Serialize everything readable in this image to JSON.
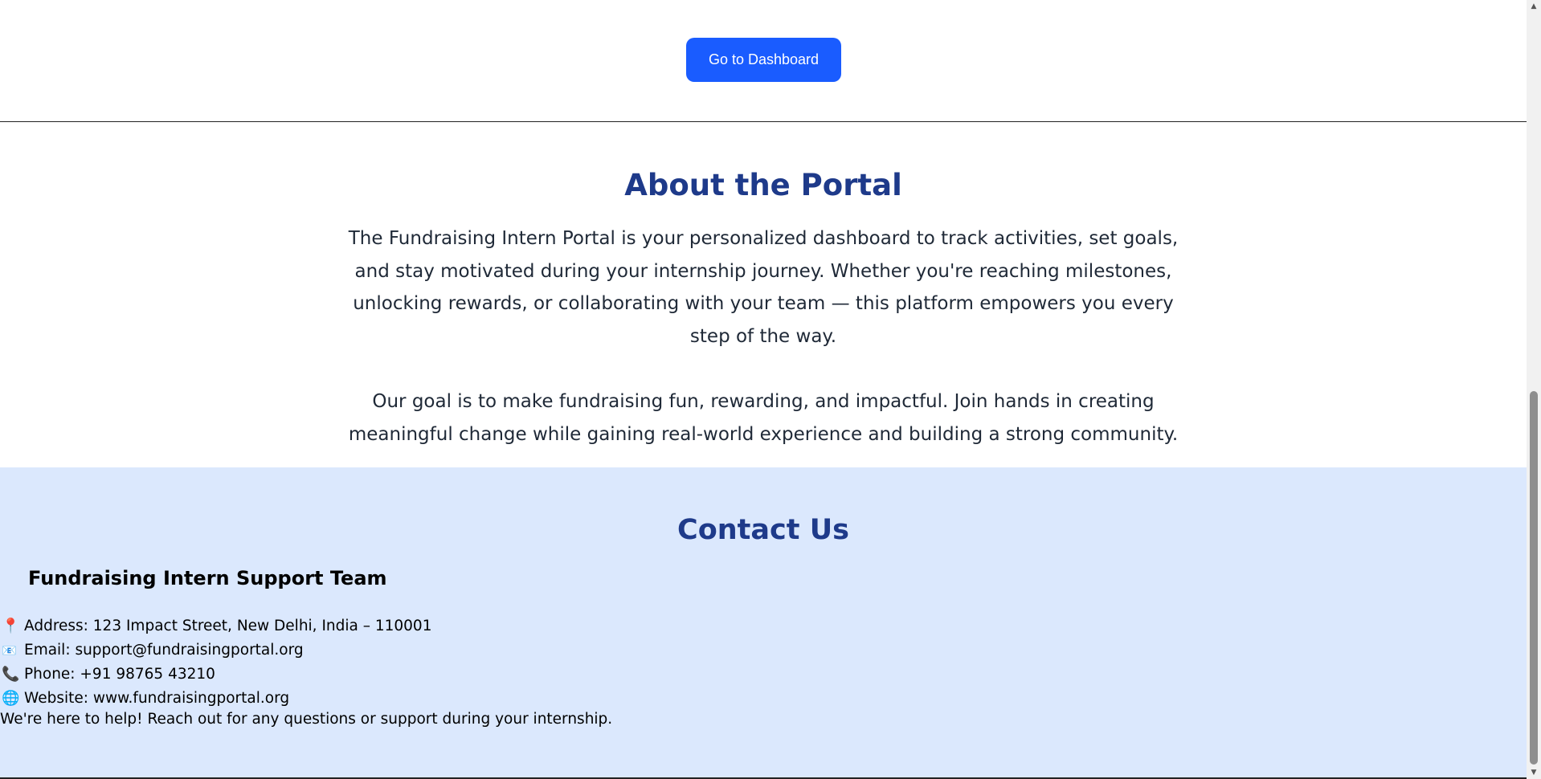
{
  "top": {
    "dashboard_button": "Go to Dashboard"
  },
  "about": {
    "title": "About the Portal",
    "paragraph1": "The Fundraising Intern Portal is your personalized dashboard to track activities, set goals, and stay motivated during your internship journey. Whether you're reaching milestones, unlocking rewards, or collaborating with your team — this platform empowers you every step of the way.",
    "paragraph2": "Our goal is to make fundraising fun, rewarding, and impactful. Join hands in creating meaningful change while gaining real-world experience and building a strong community."
  },
  "contact": {
    "title": "Contact Us",
    "team": "Fundraising Intern Support Team",
    "items": [
      {
        "icon": "pin-icon",
        "text": "Address: 123 Impact Street, New Delhi, India – 110001"
      },
      {
        "icon": "email-icon",
        "text": "Email: support@fundraisingportal.org"
      },
      {
        "icon": "phone-icon",
        "text": "Phone: +91 98765 43210"
      },
      {
        "icon": "globe-icon",
        "text": "Website: www.fundraisingportal.org"
      }
    ],
    "help_text": "We're here to help! Reach out for any questions or support during your internship."
  },
  "colors": {
    "accent": "#1a5cff",
    "heading": "#1e3a8a",
    "contact_bg": "#dbe8fd"
  }
}
